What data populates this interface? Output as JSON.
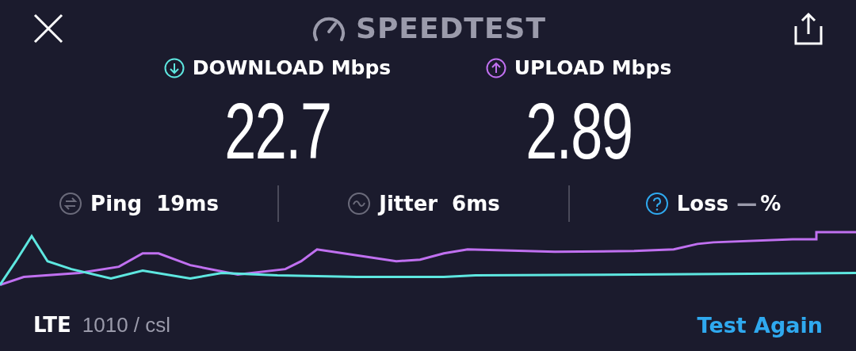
{
  "header": {
    "title": "SPEEDTEST"
  },
  "results": [
    {
      "kind": "download",
      "label": "DOWNLOAD Mbps",
      "value": "22.7"
    },
    {
      "kind": "upload",
      "label": "UPLOAD Mbps",
      "value": "2.89"
    }
  ],
  "stats": [
    {
      "kind": "ping",
      "label": "Ping",
      "value": "19ms"
    },
    {
      "kind": "jitter",
      "label": "Jitter",
      "value": "6ms"
    },
    {
      "kind": "loss",
      "label": "Loss",
      "value": "—",
      "unit": "%"
    }
  ],
  "footer": {
    "network": "LTE",
    "carrier": "1010 / csl",
    "action": "Test Again"
  }
}
